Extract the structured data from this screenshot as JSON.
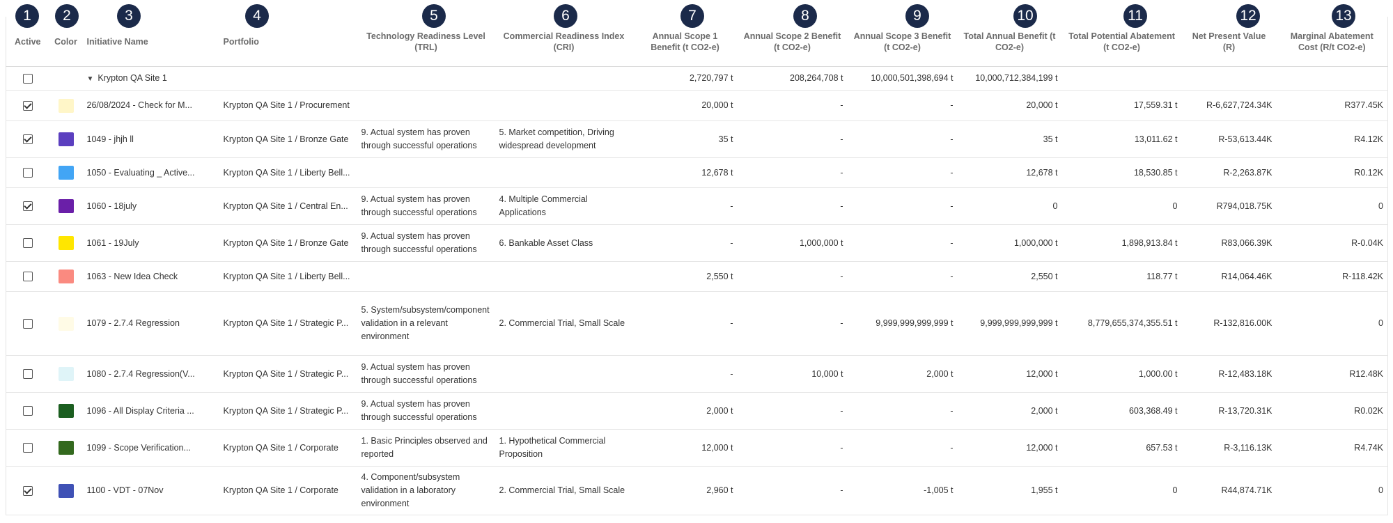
{
  "badges": [
    "1",
    "2",
    "3",
    "4",
    "5",
    "6",
    "7",
    "8",
    "9",
    "10",
    "11",
    "12",
    "13"
  ],
  "columns": {
    "active": "Active",
    "color": "Color",
    "name": "Initiative Name",
    "portfolio": "Portfolio",
    "trl": "Technology Readiness Level (TRL)",
    "cri": "Commercial Readiness Index (CRI)",
    "scope1": "Annual Scope 1 Benefit (t CO2-e)",
    "scope2": "Annual Scope 2 Benefit (t CO2-e)",
    "scope3": "Annual Scope 3 Benefit (t CO2-e)",
    "total": "Total Annual Benefit (t CO2-e)",
    "potential": "Total Potential Abatement (t CO2-e)",
    "npv": "Net Present Value (R)",
    "mac": "Marginal Abatement Cost (R/t CO2-e)"
  },
  "group": {
    "name": "Krypton QA Site 1",
    "scope1": "2,720,797 t",
    "scope2": "208,264,708 t",
    "scope3": "10,000,501,398,694 t",
    "total": "10,000,712,384,199 t"
  },
  "rows": [
    {
      "active": true,
      "color": "#fff6c8",
      "name": "26/08/2024 - Check for M...",
      "portfolio": "Krypton QA Site 1 / Procurement",
      "trl": "",
      "cri": "",
      "scope1": "20,000 t",
      "scope2": "-",
      "scope3": "-",
      "total": "20,000 t",
      "potential": "17,559.31 t",
      "npv": "R-6,627,724.34K",
      "mac": "R377.45K"
    },
    {
      "active": true,
      "color": "#5b3fbf",
      "name": "1049 - jhjh ll",
      "portfolio": "Krypton QA Site 1 / Bronze Gate",
      "trl": "9. Actual system has proven through successful operations",
      "cri": "5. Market competition, Driving widespread development",
      "scope1": "35 t",
      "scope2": "-",
      "scope3": "-",
      "total": "35 t",
      "potential": "13,011.62 t",
      "npv": "R-53,613.44K",
      "mac": "R4.12K"
    },
    {
      "active": false,
      "color": "#42a5f5",
      "name": "1050 - Evaluating _ Active...",
      "portfolio": "Krypton QA Site 1 / Liberty Bell...",
      "trl": "",
      "cri": "",
      "scope1": "12,678 t",
      "scope2": "-",
      "scope3": "-",
      "total": "12,678 t",
      "potential": "18,530.85 t",
      "npv": "R-2,263.87K",
      "mac": "R0.12K"
    },
    {
      "active": true,
      "color": "#6a1fa8",
      "name": "1060 - 18july",
      "portfolio": "Krypton QA Site 1 / Central En...",
      "trl": "9. Actual system has proven through successful operations",
      "cri": "4. Multiple Commercial Applications",
      "scope1": "-",
      "scope2": "-",
      "scope3": "-",
      "total": "0",
      "potential": "0",
      "npv": "R794,018.75K",
      "mac": "0"
    },
    {
      "active": false,
      "color": "#ffe600",
      "name": "1061 - 19July",
      "portfolio": "Krypton QA Site 1 / Bronze Gate",
      "trl": "9. Actual system has proven through successful operations",
      "cri": "6. Bankable Asset Class",
      "scope1": "-",
      "scope2": "1,000,000 t",
      "scope3": "-",
      "total": "1,000,000 t",
      "potential": "1,898,913.84 t",
      "npv": "R83,066.39K",
      "mac": "R-0.04K"
    },
    {
      "active": false,
      "color": "#fa8a80",
      "name": "1063 - New Idea Check",
      "portfolio": "Krypton QA Site 1 / Liberty Bell...",
      "trl": "",
      "cri": "",
      "scope1": "2,550 t",
      "scope2": "-",
      "scope3": "-",
      "total": "2,550 t",
      "potential": "118.77 t",
      "npv": "R14,064.46K",
      "mac": "R-118.42K"
    },
    {
      "active": false,
      "color": "#fffbe6",
      "name": "1079 - 2.7.4 Regression",
      "portfolio": "Krypton QA Site 1 / Strategic P...",
      "trl": "5. System/subsystem/component validation in a relevant environment",
      "cri": "2. Commercial Trial, Small Scale",
      "scope1": "-",
      "scope2": "-",
      "scope3": "9,999,999,999,999 t",
      "total": "9,999,999,999,999 t",
      "potential": "8,779,655,374,355.51 t",
      "npv": "R-132,816.00K",
      "mac": "0"
    },
    {
      "active": false,
      "color": "#dff4f8",
      "name": "1080 - 2.7.4 Regression(V...",
      "portfolio": "Krypton QA Site 1 / Strategic P...",
      "trl": "9. Actual system has proven through successful operations",
      "cri": "",
      "scope1": "-",
      "scope2": "10,000 t",
      "scope3": "2,000 t",
      "total": "12,000 t",
      "potential": "1,000.00 t",
      "npv": "R-12,483.18K",
      "mac": "R12.48K"
    },
    {
      "active": false,
      "color": "#1b5e20",
      "name": "1096 - All Display Criteria ...",
      "portfolio": "Krypton QA Site 1 / Strategic P...",
      "trl": "9. Actual system has proven through successful operations",
      "cri": "",
      "scope1": "2,000 t",
      "scope2": "-",
      "scope3": "-",
      "total": "2,000 t",
      "potential": "603,368.49 t",
      "npv": "R-13,720.31K",
      "mac": "R0.02K"
    },
    {
      "active": false,
      "color": "#33691e",
      "name": "1099 - Scope Verification...",
      "portfolio": "Krypton QA Site 1 / Corporate",
      "trl": "1. Basic Principles observed and reported",
      "cri": "1. Hypothetical Commercial Proposition",
      "scope1": "12,000 t",
      "scope2": "-",
      "scope3": "-",
      "total": "12,000 t",
      "potential": "657.53 t",
      "npv": "R-3,116.13K",
      "mac": "R4.74K"
    },
    {
      "active": true,
      "color": "#3f51b5",
      "name": "1100 - VDT - 07Nov",
      "portfolio": "Krypton QA Site 1 / Corporate",
      "trl": "4. Component/subsystem validation in a laboratory environment",
      "cri": "2. Commercial Trial, Small Scale",
      "scope1": "2,960 t",
      "scope2": "-",
      "scope3": "-1,005 t",
      "total": "1,955 t",
      "potential": "0",
      "npv": "R44,874.71K",
      "mac": "0"
    }
  ]
}
